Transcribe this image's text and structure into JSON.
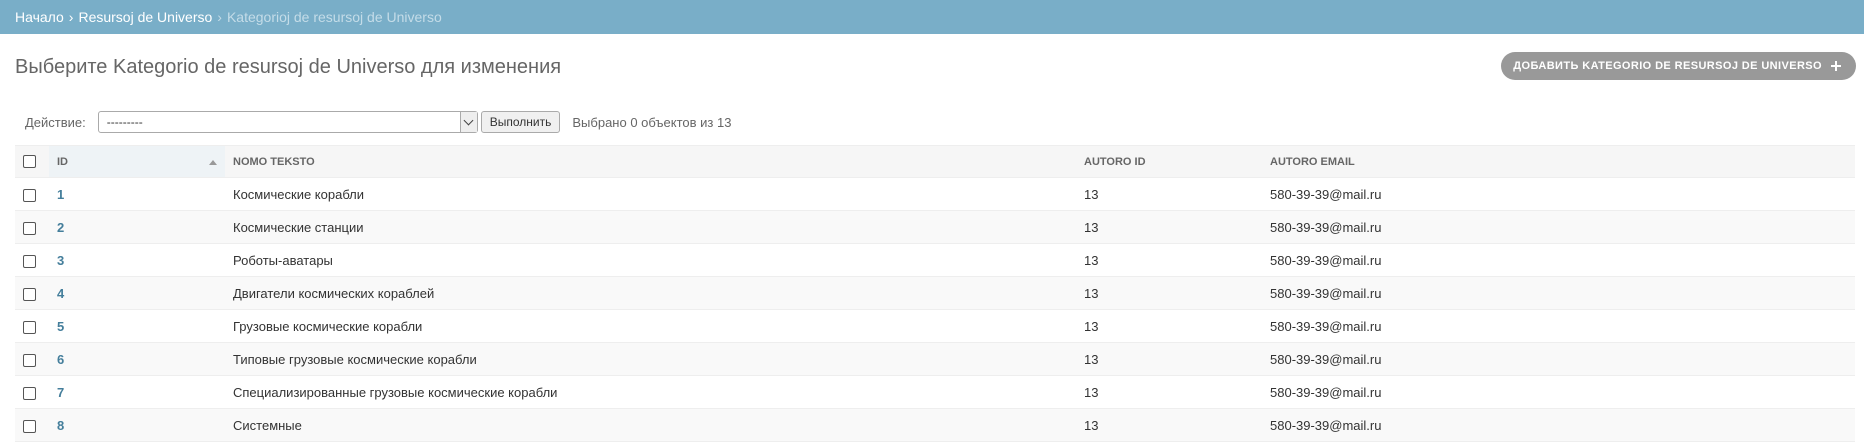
{
  "breadcrumbs": {
    "home": "Начало",
    "app": "Resursoj de Universo",
    "current": "Kategorioj de resursoj de Universo",
    "separator": "›"
  },
  "page_title": "Выберите Kategorio de resursoj de Universo для изменения",
  "add_button": {
    "label": "Добавить Kategorio de resursoj de Universo"
  },
  "actions": {
    "label": "Действие:",
    "selected_value": "---------",
    "run_label": "Выполнить",
    "selected_count": "Выбрано 0 объектов из 13"
  },
  "table": {
    "columns": [
      "ID",
      "Nomo teksto",
      "Autoro id",
      "Autoro email"
    ],
    "rows": [
      {
        "id": "1",
        "name": "Космические корабли",
        "author_id": "13",
        "email": "580-39-39@mail.ru"
      },
      {
        "id": "2",
        "name": "Космические станции",
        "author_id": "13",
        "email": "580-39-39@mail.ru"
      },
      {
        "id": "3",
        "name": "Роботы-аватары",
        "author_id": "13",
        "email": "580-39-39@mail.ru"
      },
      {
        "id": "4",
        "name": "Двигатели космических кораблей",
        "author_id": "13",
        "email": "580-39-39@mail.ru"
      },
      {
        "id": "5",
        "name": "Грузовые космические корабли",
        "author_id": "13",
        "email": "580-39-39@mail.ru"
      },
      {
        "id": "6",
        "name": "Типовые грузовые космические корабли",
        "author_id": "13",
        "email": "580-39-39@mail.ru"
      },
      {
        "id": "7",
        "name": "Специализированные грузовые космические корабли",
        "author_id": "13",
        "email": "580-39-39@mail.ru"
      },
      {
        "id": "8",
        "name": "Системные",
        "author_id": "13",
        "email": "580-39-39@mail.ru"
      }
    ]
  },
  "colors": {
    "header_bar": "#79aec8",
    "link": "#447e9b",
    "add_button_bg": "#999999"
  }
}
